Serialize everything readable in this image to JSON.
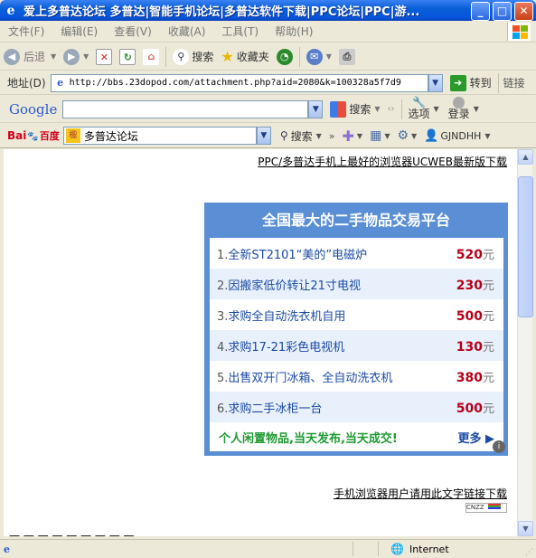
{
  "window": {
    "title": "爱上多普达论坛 多普达|智能手机论坛|多普达软件下载|PPC论坛|PPC|游...",
    "minimize": "_",
    "maximize": "□",
    "close": "✕"
  },
  "menu": [
    "文件(F)",
    "编辑(E)",
    "查看(V)",
    "收藏(A)",
    "工具(T)",
    "帮助(H)"
  ],
  "toolbar": {
    "back_label": "后退",
    "search_label": "搜索",
    "favorites_label": "收藏夹"
  },
  "address": {
    "label": "地址(D)",
    "url": "http://bbs.23dopod.com/attachment.php?aid=2080&k=100328a5f7d9",
    "go_label": "转到",
    "links_label": "链接"
  },
  "google": {
    "logo": "Google",
    "search_label": "搜索",
    "options_label": "选项",
    "login_label": "登录"
  },
  "baidu": {
    "logo_a": "Bai",
    "logo_b": "百度",
    "query": "多普达论坛",
    "search_label": "搜索",
    "user": "GJNDHH"
  },
  "page": {
    "top_link": "PPC/多普达手机上最好的浏览器UCWEB最新版下载",
    "ad_title": "全国最大的二手物品交易平台",
    "items": [
      {
        "num": "1.",
        "text": "全新ST2101“美的”电磁炉",
        "price": "520",
        "unit": "元"
      },
      {
        "num": "2.",
        "text": "因搬家低价转让21寸电视",
        "price": "230",
        "unit": "元"
      },
      {
        "num": "3.",
        "text": "求购全自动洗衣机自用",
        "price": "500",
        "unit": "元"
      },
      {
        "num": "4.",
        "text": "求购17-21彩色电视机",
        "price": "130",
        "unit": "元"
      },
      {
        "num": "5.",
        "text": "出售双开门冰箱、全自动洗衣机",
        "price": "380",
        "unit": "元"
      },
      {
        "num": "6.",
        "text": "求购二手冰柜一台",
        "price": "500",
        "unit": "元"
      }
    ],
    "ad_foot": "个人闲置物品,当天发布,当天成交!",
    "more": "更多",
    "bottom_link": "手机浏览器用户请用此文字链接下载",
    "cnzz": "CNZZ"
  },
  "status": {
    "zone": "Internet"
  }
}
